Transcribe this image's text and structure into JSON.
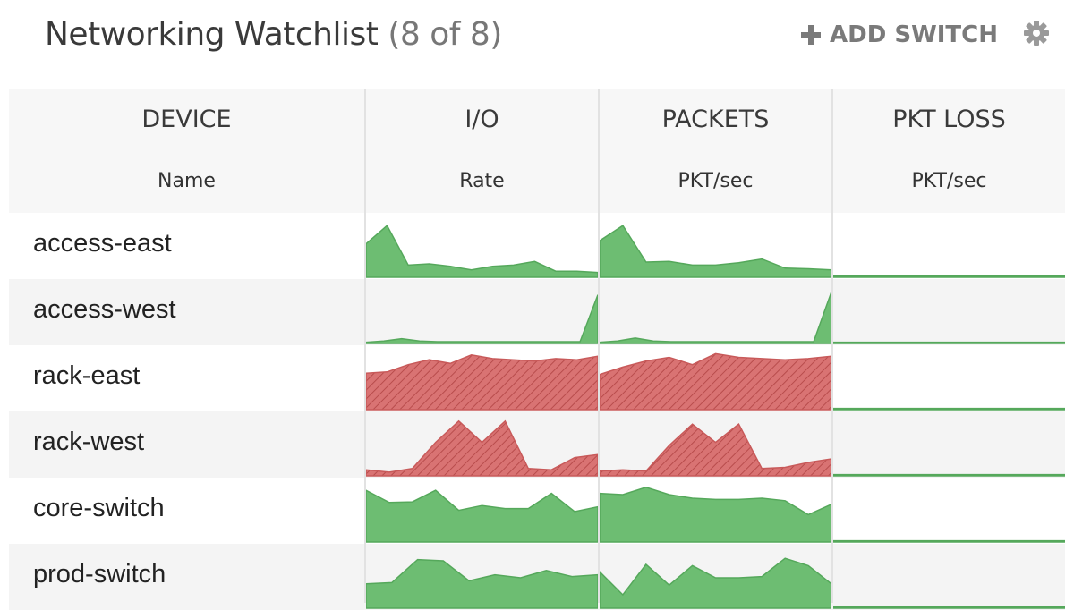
{
  "header": {
    "title": "Networking Watchlist",
    "count": "(8 of 8)",
    "add_label": "ADD SWITCH",
    "add_icon": "plus-icon",
    "settings_icon": "gear-icon"
  },
  "columns": [
    {
      "label": "DEVICE",
      "sub": "Name"
    },
    {
      "label": "I/O",
      "sub": "Rate"
    },
    {
      "label": "PACKETS",
      "sub": "PKT/sec"
    },
    {
      "label": "PKT LOSS",
      "sub": "PKT/sec"
    }
  ],
  "colors": {
    "ok_fill": "#6dbd72",
    "ok_line": "#55a85b",
    "alert_fill": "#d97373",
    "alert_line": "#c85a5a",
    "alert_hatch": "#b84c4c"
  },
  "rows": [
    {
      "name": "access-east",
      "status": "ok",
      "io": [
        0.55,
        0.85,
        0.2,
        0.22,
        0.18,
        0.12,
        0.18,
        0.2,
        0.26,
        0.1,
        0.1,
        0.08
      ],
      "packets": [
        0.6,
        0.85,
        0.25,
        0.26,
        0.2,
        0.2,
        0.24,
        0.3,
        0.15,
        0.14,
        0.12
      ],
      "loss": [
        0.02,
        0.02
      ]
    },
    {
      "name": "access-west",
      "status": "ok",
      "io": [
        0.02,
        0.04,
        0.08,
        0.04,
        0.03,
        0.03,
        0.03,
        0.03,
        0.03,
        0.03,
        0.03,
        0.03,
        0.03,
        0.8
      ],
      "packets": [
        0.02,
        0.04,
        0.09,
        0.04,
        0.03,
        0.03,
        0.03,
        0.03,
        0.03,
        0.03,
        0.03,
        0.03,
        0.03,
        0.85
      ],
      "loss": [
        0.02,
        0.02
      ]
    },
    {
      "name": "rack-east",
      "status": "alert",
      "io": [
        0.6,
        0.62,
        0.74,
        0.82,
        0.76,
        0.9,
        0.84,
        0.82,
        0.8,
        0.84,
        0.82,
        0.88
      ],
      "packets": [
        0.58,
        0.7,
        0.8,
        0.86,
        0.74,
        0.92,
        0.86,
        0.84,
        0.82,
        0.84,
        0.88
      ],
      "loss": [
        0.02,
        0.02
      ]
    },
    {
      "name": "rack-west",
      "status": "alert",
      "io": [
        0.1,
        0.06,
        0.12,
        0.55,
        0.9,
        0.55,
        0.9,
        0.12,
        0.1,
        0.3,
        0.35
      ],
      "packets": [
        0.08,
        0.1,
        0.08,
        0.5,
        0.85,
        0.55,
        0.85,
        0.12,
        0.14,
        0.22,
        0.28
      ],
      "loss": [
        0.02,
        0.02
      ]
    },
    {
      "name": "core-switch",
      "status": "ok",
      "io": [
        0.85,
        0.65,
        0.66,
        0.85,
        0.52,
        0.6,
        0.55,
        0.55,
        0.8,
        0.5,
        0.58
      ],
      "packets": [
        0.8,
        0.78,
        0.9,
        0.78,
        0.72,
        0.7,
        0.7,
        0.72,
        0.68,
        0.45,
        0.62
      ],
      "loss": [
        0.02,
        0.02
      ]
    },
    {
      "name": "prod-switch",
      "status": "ok",
      "io": [
        0.4,
        0.42,
        0.8,
        0.78,
        0.45,
        0.55,
        0.5,
        0.62,
        0.52,
        0.55
      ],
      "packets": [
        0.6,
        0.22,
        0.72,
        0.38,
        0.7,
        0.5,
        0.5,
        0.52,
        0.82,
        0.7,
        0.4
      ],
      "loss": [
        0.02,
        0.02
      ]
    }
  ]
}
